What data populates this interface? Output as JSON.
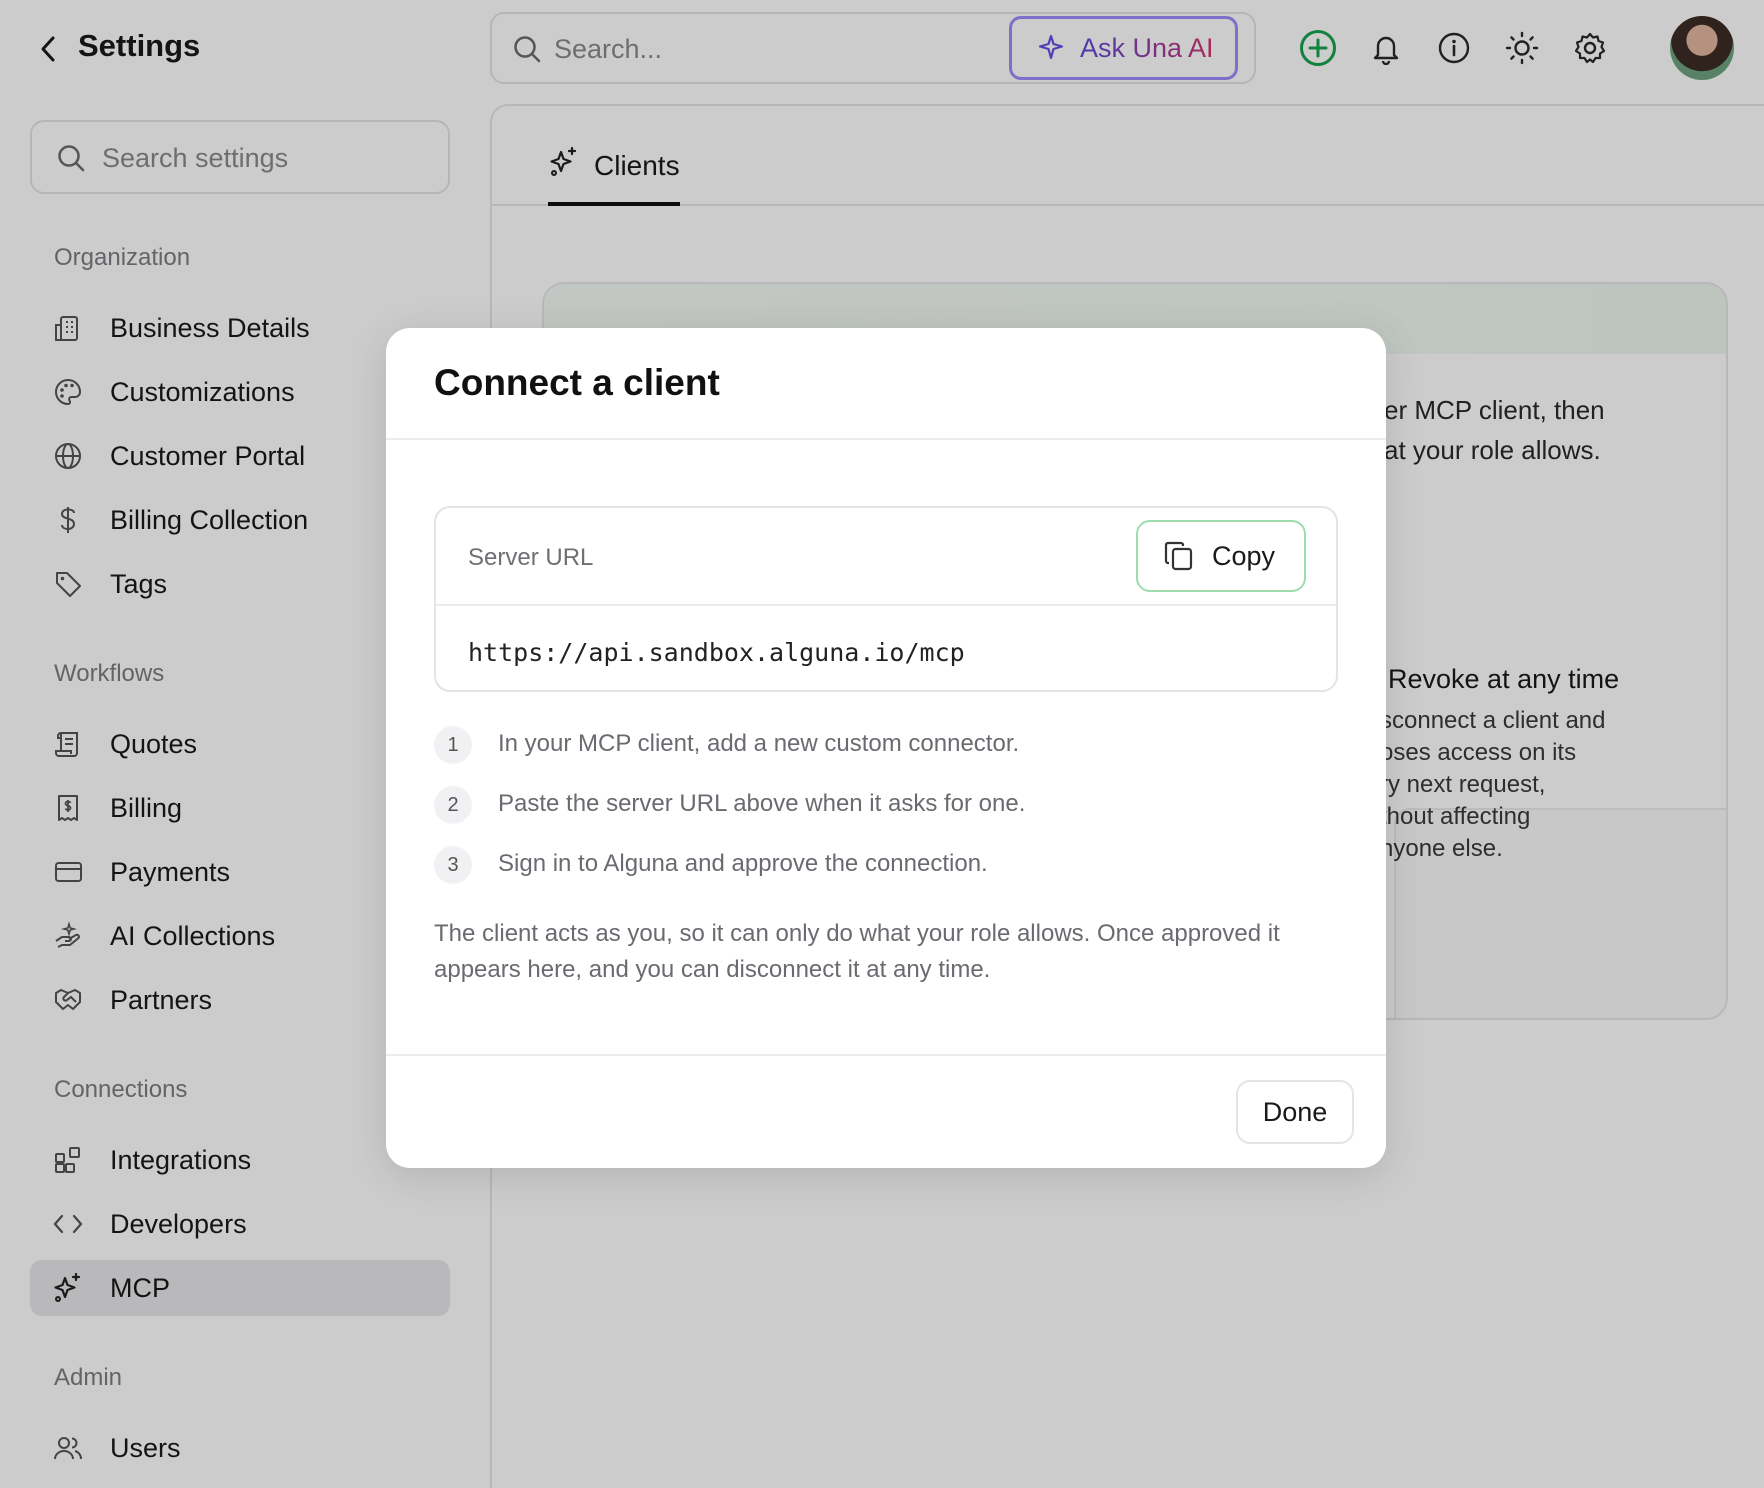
{
  "header": {
    "title": "Settings",
    "search_placeholder": "Search...",
    "ask_button_label": "Ask Una AI",
    "icons": [
      "plus-circle-icon",
      "bell-icon",
      "info-icon",
      "sun-icon",
      "gear-icon",
      "avatar"
    ]
  },
  "sidebar": {
    "search_placeholder": "Search settings",
    "sections": [
      {
        "label": "Organization",
        "items": [
          {
            "label": "Business Details",
            "icon": "building-icon"
          },
          {
            "label": "Customizations",
            "icon": "palette-icon"
          },
          {
            "label": "Customer Portal",
            "icon": "globe-icon"
          },
          {
            "label": "Billing Collection",
            "icon": "dollar-icon"
          },
          {
            "label": "Tags",
            "icon": "tag-icon"
          }
        ]
      },
      {
        "label": "Workflows",
        "items": [
          {
            "label": "Quotes",
            "icon": "scroll-icon"
          },
          {
            "label": "Billing",
            "icon": "receipt-icon"
          },
          {
            "label": "Payments",
            "icon": "credit-card-icon"
          },
          {
            "label": "AI Collections",
            "icon": "ai-hand-icon"
          },
          {
            "label": "Partners",
            "icon": "handshake-icon"
          }
        ]
      },
      {
        "label": "Connections",
        "items": [
          {
            "label": "Integrations",
            "icon": "blocks-icon"
          },
          {
            "label": "Developers",
            "icon": "code-icon"
          },
          {
            "label": "MCP",
            "icon": "sparkles-icon",
            "active": true
          }
        ]
      },
      {
        "label": "Admin",
        "items": [
          {
            "label": "Users",
            "icon": "users-icon"
          }
        ]
      }
    ]
  },
  "main": {
    "tab_label": "Clients",
    "background_text": {
      "line1": "er MCP client, then",
      "line2": "at your role allows.",
      "revoke_title": "Revoke at any time",
      "revoke_body": "sconnect a client and\noses access on its\nry next request,\nthout affecting\nnyone else."
    }
  },
  "modal": {
    "title": "Connect a client",
    "server_url_label": "Server URL",
    "copy_label": "Copy",
    "server_url": "https://api.sandbox.alguna.io/mcp",
    "steps": [
      {
        "num": "1",
        "text": "In your MCP client, add a new custom connector."
      },
      {
        "num": "2",
        "text": "Paste the server URL above when it asks for one."
      },
      {
        "num": "3",
        "text": "Sign in to Alguna and approve the connection."
      }
    ],
    "note": "The client acts as you, so it can only do what your role allows. Once approved it appears here, and you can disconnect it at any time.",
    "done_label": "Done"
  },
  "colors": {
    "accent_green": "#16a34a",
    "ask_gradient_start": "#5b4be0",
    "ask_gradient_end": "#d0346f",
    "copy_border": "#9fdcab"
  }
}
